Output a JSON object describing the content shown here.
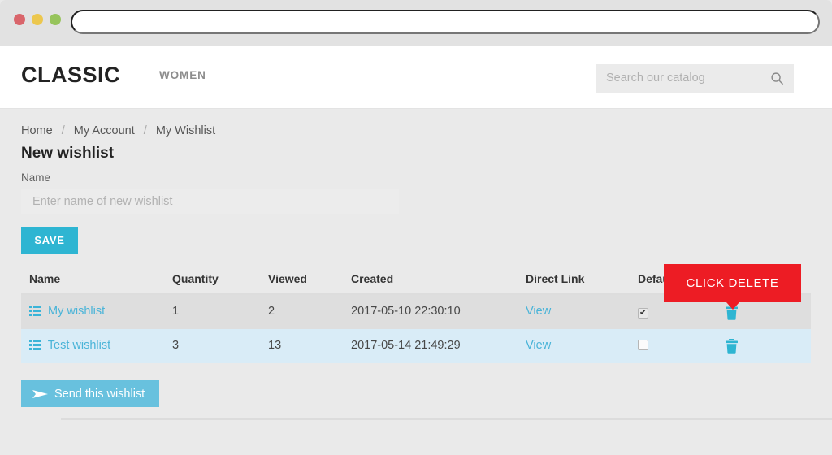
{
  "browser": {
    "url_value": "",
    "url_placeholder": ""
  },
  "header": {
    "brand": "CLASSIC",
    "nav": [
      {
        "label": "WOMEN"
      }
    ],
    "search": {
      "placeholder": "Search our catalog",
      "value": "",
      "icon": "search-icon"
    }
  },
  "breadcrumb": {
    "items": [
      {
        "label": "Home"
      },
      {
        "label": "My Account"
      },
      {
        "label": "My Wishlist"
      }
    ],
    "separator": "/"
  },
  "form": {
    "title": "New wishlist",
    "name_label": "Name",
    "name_placeholder": "Enter name of new wishlist",
    "name_value": "",
    "save_label": "SAVE"
  },
  "table": {
    "columns": [
      {
        "key": "name",
        "label": "Name"
      },
      {
        "key": "quantity",
        "label": "Quantity"
      },
      {
        "key": "viewed",
        "label": "Viewed"
      },
      {
        "key": "created",
        "label": "Created"
      },
      {
        "key": "link",
        "label": "Direct Link"
      },
      {
        "key": "default",
        "label": "Default"
      },
      {
        "key": "delete",
        "label": ""
      }
    ],
    "rows": [
      {
        "name": "My wishlist",
        "name_icon": "list-icon",
        "quantity": "1",
        "viewed": "2",
        "created": "2017-05-10 22:30:10",
        "link_label": "View",
        "default_checked": true,
        "default_mark": "✔",
        "delete_icon": "trash-icon",
        "row_state": "hovered"
      },
      {
        "name": "Test wishlist",
        "name_icon": "list-icon",
        "quantity": "3",
        "viewed": "13",
        "created": "2017-05-14 21:49:29",
        "link_label": "View",
        "default_checked": false,
        "default_mark": "",
        "delete_icon": "trash-icon",
        "row_state": "striped"
      }
    ]
  },
  "tooltip": {
    "text": "CLICK DELETE",
    "background_color": "#ed1c24",
    "text_color": "#ffffff"
  },
  "actions": {
    "send_label": "Send this wishlist",
    "send_icon": "paper-plane-icon"
  },
  "colors": {
    "accent_cyan": "#2eb5d2",
    "link_cyan": "#4ab4d8",
    "send_blue": "#68c1de",
    "alert_red": "#ed1c24",
    "page_background": "#eaeaea",
    "row_hover": "#dedede",
    "row_stripe": "#d9ecf7"
  }
}
